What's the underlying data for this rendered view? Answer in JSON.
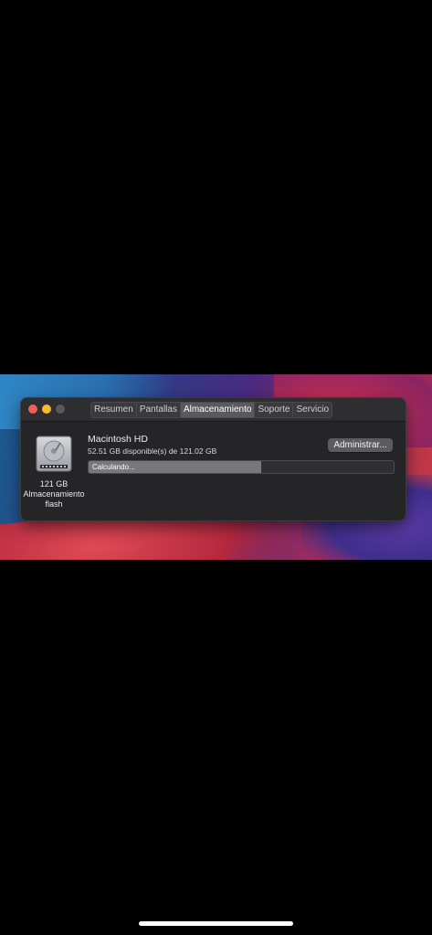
{
  "window": {
    "tabs": [
      {
        "label": "Resumen",
        "active": false
      },
      {
        "label": "Pantallas",
        "active": false
      },
      {
        "label": "Almacenamiento",
        "active": true
      },
      {
        "label": "Soporte",
        "active": false
      },
      {
        "label": "Servicio",
        "active": false
      }
    ]
  },
  "disk": {
    "icon": "hard-drive-icon",
    "size_line1": "121 GB",
    "size_line2": "Almacenamiento",
    "size_line3": "flash",
    "name": "Macintosh HD",
    "available": "52.51 GB disponible(s) de 121.02 GB",
    "manage_label": "Administrar...",
    "progress_label": "Calculando...",
    "progress_fraction": 0.565
  },
  "colors": {
    "close": "#ed5f58",
    "minimize": "#f5bd2f",
    "maximize_disabled": "#5a5a5e"
  }
}
